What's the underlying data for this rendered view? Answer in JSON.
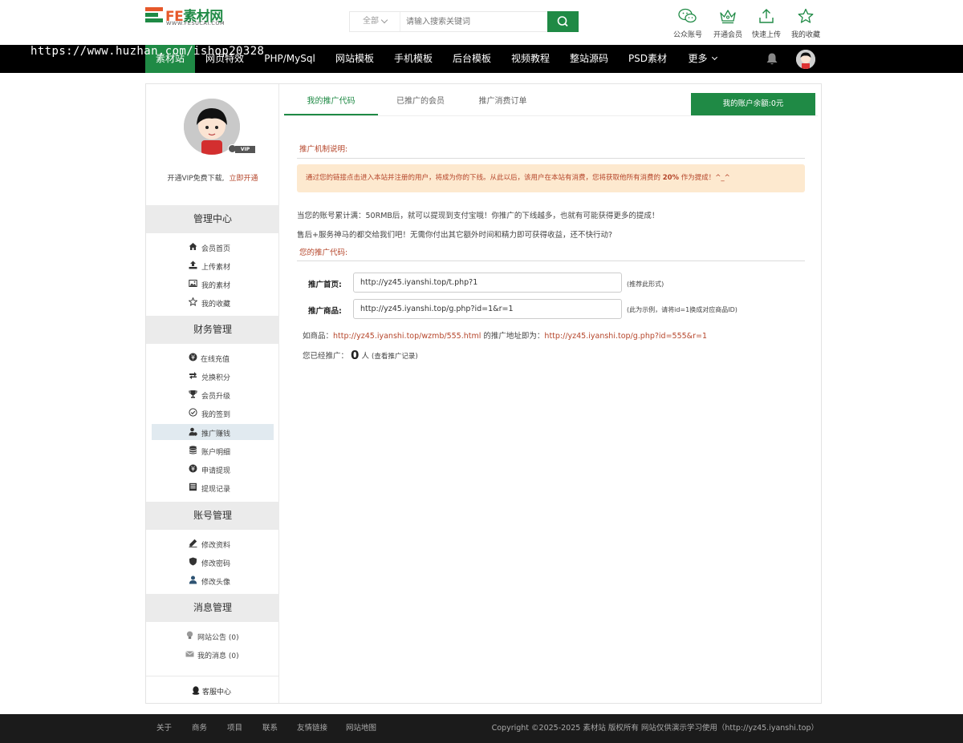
{
  "header": {
    "logo_brand_fe": "FE",
    "logo_brand_text": "素材网",
    "logo_sub": "WWW.FESUCAI.COM",
    "search": {
      "category": "全部",
      "placeholder": "请输入搜索关键词"
    },
    "actions": [
      {
        "label": "公众账号",
        "icon": "wechat-icon"
      },
      {
        "label": "开通会员",
        "icon": "crown-icon"
      },
      {
        "label": "快速上传",
        "icon": "upload-icon"
      },
      {
        "label": "我的收藏",
        "icon": "star-icon"
      }
    ]
  },
  "watermark": "https://www.huzhan.com/ishop20328",
  "nav": {
    "items": [
      "素材站",
      "网页特效",
      "PHP/MySql",
      "网站模板",
      "手机模板",
      "后台模板",
      "视频教程",
      "整站源码",
      "PSD素材",
      "更多"
    ],
    "active": 0
  },
  "sidebar": {
    "vip_badge": "VIP",
    "vip_note": "开通VIP免费下载,",
    "vip_link": "立即开通",
    "sections": [
      {
        "title": "管理中心",
        "items": [
          {
            "label": "会员首页",
            "icon": "home-icon"
          },
          {
            "label": "上传素材",
            "icon": "upload-icon"
          },
          {
            "label": "我的素材",
            "icon": "image-icon"
          },
          {
            "label": "我的收藏",
            "icon": "star-icon"
          }
        ]
      },
      {
        "title": "财务管理",
        "items": [
          {
            "label": "在线充值",
            "icon": "yen-icon"
          },
          {
            "label": "兑换积分",
            "icon": "exchange-icon"
          },
          {
            "label": "会员升级",
            "icon": "trophy-icon"
          },
          {
            "label": "我的签到",
            "icon": "check-circle-icon"
          },
          {
            "label": "推广赚钱",
            "icon": "user-money-icon",
            "selected": true
          },
          {
            "label": "账户明细",
            "icon": "database-icon"
          },
          {
            "label": "申请提现",
            "icon": "yen-icon"
          },
          {
            "label": "提现记录",
            "icon": "ledger-icon"
          }
        ]
      },
      {
        "title": "账号管理",
        "items": [
          {
            "label": "修改资料",
            "icon": "edit-icon"
          },
          {
            "label": "修改密码",
            "icon": "shield-icon"
          },
          {
            "label": "修改头像",
            "icon": "user-icon"
          }
        ]
      },
      {
        "title": "消息管理",
        "items": [
          {
            "label": "网站公告 (0)",
            "icon": "bulb-icon"
          },
          {
            "label": "我的消息 (0)",
            "icon": "mail-icon"
          }
        ]
      }
    ],
    "service": "客服中心"
  },
  "content": {
    "tabs": [
      "我的推广代码",
      "已推广的会员",
      "推广消费订单"
    ],
    "active_tab": 0,
    "balance": "我的账户余额:0元",
    "mechanism_title": "推广机制说明:",
    "notice_before": "通过您的链接点击进入本站并注册的用户，将成为你的下线。从此以后，该用户在本站有消费，您将获取他所有消费的",
    "notice_percent": "20%",
    "notice_after": "作为提成！^_^",
    "para1": "当您的账号累计满：50RMB后，就可以提现到支付宝哦！你推广的下线越多，也就有可能获得更多的提成！",
    "para2": "售后+服务神马的都交给我们吧！无需你付出其它额外时间和精力即可获得收益，还不快行动?",
    "code_title": "您的推广代码:",
    "fields": [
      {
        "label": "推广首页:",
        "value": "http://yz45.iyanshi.top/t.php?1",
        "note": "(推荐此形式)"
      },
      {
        "label": "推广商品:",
        "value": "http://yz45.iyanshi.top/g.php?id=1&r=1",
        "note": "(此为示例，请将id=1换成对应商品ID)"
      }
    ],
    "example_prefix": "如商品：",
    "example_link": "http://yz45.iyanshi.top/wzmb/555.html",
    "example_mid": "的推广地址即为：",
    "example_result": "http://yz45.iyanshi.top/g.php?id=555&r=1",
    "count_prefix": "您已经推广：",
    "count": "0",
    "count_unit": "人",
    "count_link": "(查看推广记录)"
  },
  "footer": {
    "links": [
      "关于",
      "商务",
      "项目",
      "联系",
      "友情链接",
      "网站地图"
    ],
    "copyright": "Copyright ©2025-2025 素材站 版权所有 网站仅供演示学习使用（http://yz45.iyanshi.top）"
  },
  "colors": {
    "brand_green": "#1f8a45",
    "accent_red": "#b5452a",
    "notice_bg": "#fde9cf",
    "nav_bg": "#000000",
    "footer_bg": "#1b1b1b"
  }
}
